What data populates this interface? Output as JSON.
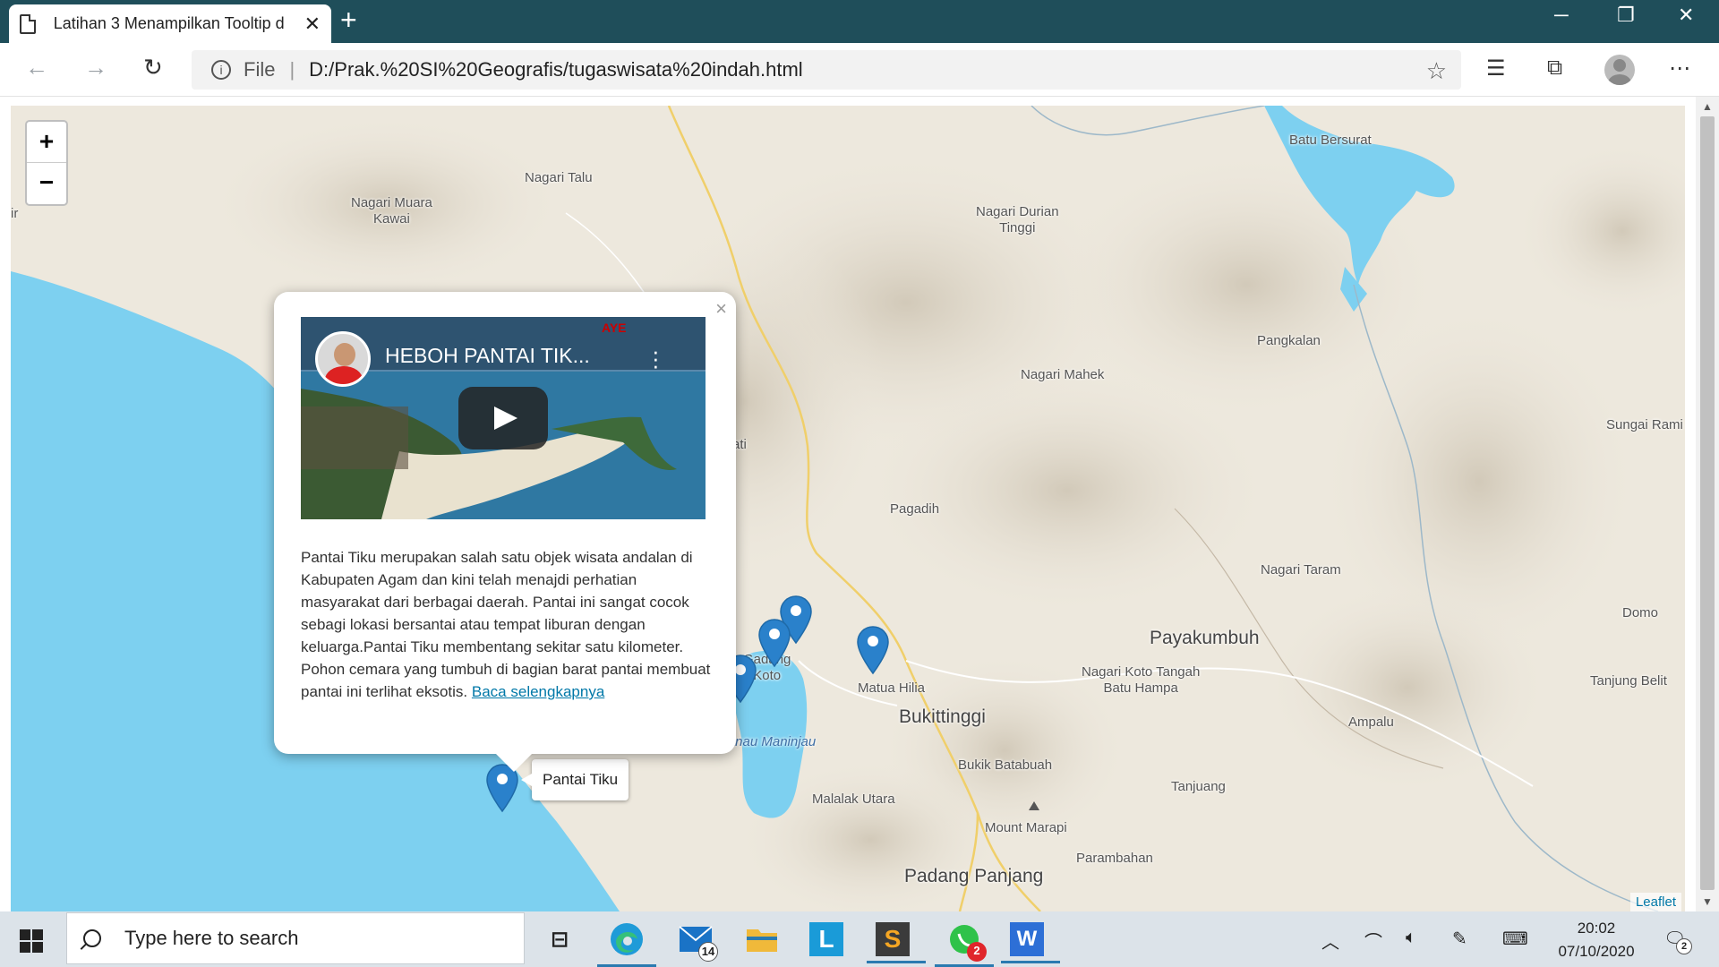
{
  "browser": {
    "tab_title": "Latihan 3 Menampilkan Tooltip d",
    "tab_close": "✕",
    "new_tab": "+",
    "address_scheme": "File",
    "address_url": "D:/Prak.%20SI%20Geografis/tugaswisata%20indah.html",
    "window_controls": [
      "─",
      "❐",
      "✕"
    ]
  },
  "map": {
    "zoom_in": "+",
    "zoom_out": "−",
    "attribution": "Leaflet",
    "places": [
      {
        "name": "Nagari Talu"
      },
      {
        "name": "Nagari Muara\nKawai"
      },
      {
        "name": "Nagari Durian\nTinggi"
      },
      {
        "name": "Batu Bersurat"
      },
      {
        "name": "Pangkalan"
      },
      {
        "name": "Nagari Mahek"
      },
      {
        "name": "Sungai Rami"
      },
      {
        "name": "Pagadih"
      },
      {
        "name": "Nagari Taram"
      },
      {
        "name": "Domo"
      },
      {
        "name": "Payakumbuh"
      },
      {
        "name": "Nagari Koto Tangah\nBatu Hampa"
      },
      {
        "name": "Tanjung Belit"
      },
      {
        "name": "Matua Hilia"
      },
      {
        "name": "Bukittinggi"
      },
      {
        "name": "Ampalu"
      },
      {
        "name": "Bukik Batabuah"
      },
      {
        "name": "Tanjuang"
      },
      {
        "name": "Malalak Utara"
      },
      {
        "name": "Mount Marapi"
      },
      {
        "name": "Parambahan"
      },
      {
        "name": "Padang Panjang"
      },
      {
        "name": "Gadang\nKoto"
      },
      {
        "name": "ati"
      },
      {
        "name": "ir"
      },
      {
        "name": "Danau Maninjau"
      }
    ],
    "popup": {
      "close": "×",
      "video_title": "HEBOH PANTAI TIK...",
      "video_watermark": "AYE",
      "description": "Pantai Tiku merupakan salah satu objek wisata andalan di Kabupaten Agam dan kini telah menajdi perhatian masyarakat dari berbagai daerah. Pantai ini sangat cocok sebagi lokasi bersantai atau tempat liburan dengan keluarga.Pantai Tiku membentang sekitar satu kilometer. Pohon cemara yang tumbuh di bagian barat pantai membuat pantai ini terlihat eksotis.",
      "read_more": "Baca selengkapnya"
    },
    "tooltip": "Pantai Tiku",
    "marker_color": "#2a81cb"
  },
  "taskbar": {
    "search_placeholder": "Type here to search",
    "mail_badge": "14",
    "whatsapp_badge": "2",
    "notification_badge": "2",
    "time": "20:02",
    "date": "07/10/2020"
  }
}
